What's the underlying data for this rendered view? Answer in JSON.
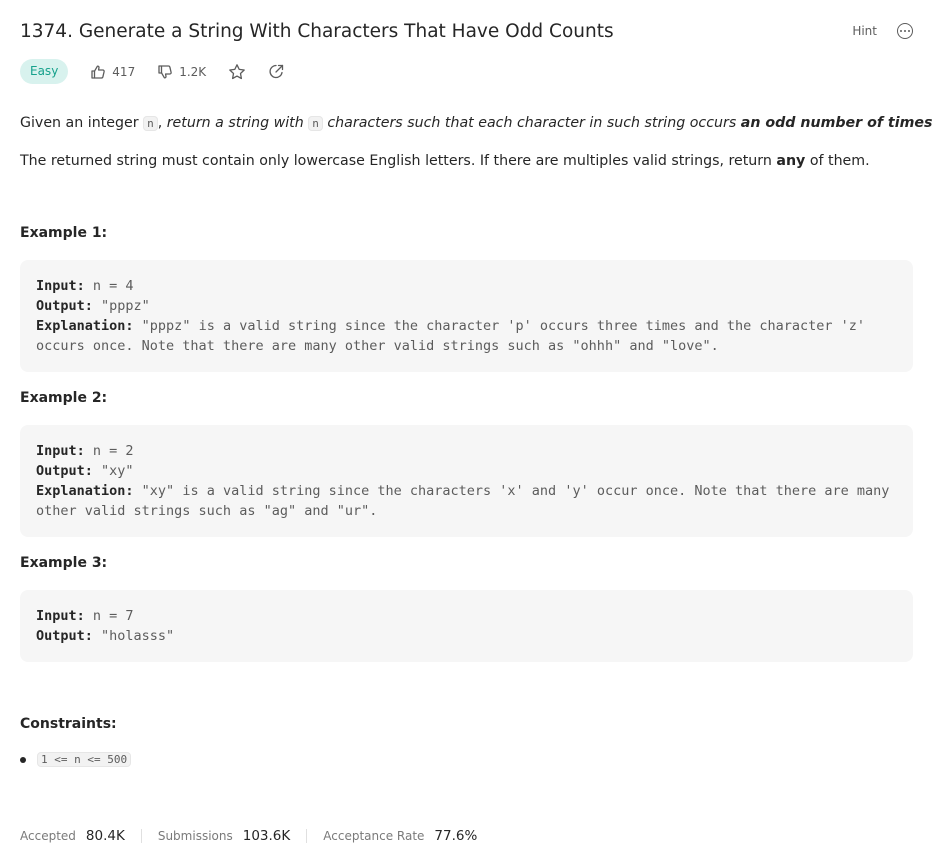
{
  "problem": {
    "title": "1374. Generate a String With Characters That Have Odd Counts",
    "difficulty": "Easy",
    "likes": "417",
    "dislikes": "1.2K",
    "hint_label": "Hint"
  },
  "description": {
    "p1_given": "Given an integer ",
    "p1_var1": "n",
    "p1_sep": ", ",
    "p1_italic1": "return a string with ",
    "p1_var2": "n",
    "p1_italic2": " characters such that each character in such string occurs ",
    "p1_bold": "an odd number of times",
    "p1_end": ".",
    "p2_text": "The returned string must contain only lowercase English letters. If there are multiples valid strings, return ",
    "p2_bold": "any",
    "p2_end": " of them."
  },
  "examples": [
    {
      "title": "Example 1:",
      "input_label": "Input:",
      "input": " n = 4",
      "output_label": "Output:",
      "output": " \"pppz\"",
      "explanation_label": "Explanation:",
      "explanation_line1": " \"pppz\" is a valid string since the character 'p' occurs three times and the character 'z'",
      "explanation_line2": "occurs once. Note that there are many other valid strings such as \"ohhh\" and \"love\"."
    },
    {
      "title": "Example 2:",
      "input_label": "Input:",
      "input": " n = 2",
      "output_label": "Output:",
      "output": " \"xy\"",
      "explanation_label": "Explanation:",
      "explanation_line1": " \"xy\" is a valid string since the characters 'x' and 'y' occur once. Note that there are many",
      "explanation_line2": "other valid strings such as \"ag\" and \"ur\"."
    },
    {
      "title": "Example 3:",
      "input_label": "Input:",
      "input": " n = 7",
      "output_label": "Output:",
      "output": " \"holasss\""
    }
  ],
  "constraints": {
    "title": "Constraints:",
    "items": [
      "1 <= n <= 500"
    ]
  },
  "stats": {
    "accepted_label": "Accepted",
    "accepted_value": "80.4K",
    "submissions_label": "Submissions",
    "submissions_value": "103.6K",
    "acceptance_label": "Acceptance Rate",
    "acceptance_value": "77.6%"
  },
  "colors": {
    "easy_text": "#16a18c",
    "easy_bg": "#d8f2ee",
    "code_bg": "#f6f6f6"
  },
  "icons": [
    "thumbs-up-icon",
    "thumbs-down-icon",
    "star-icon",
    "share-icon",
    "more-icon"
  ]
}
